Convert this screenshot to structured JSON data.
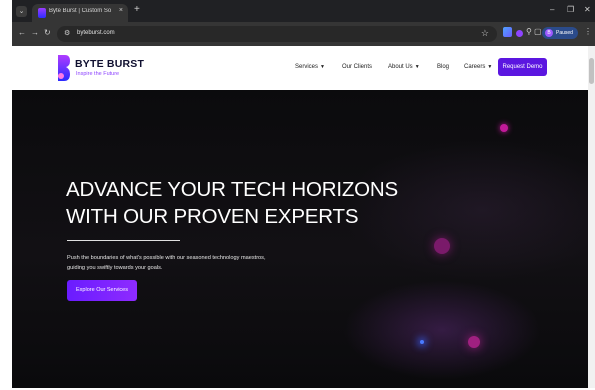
{
  "browser": {
    "tab_title": "Byte Burst | Custom Software",
    "tab_close": "×",
    "new_tab": "+",
    "tab_list": "⌄",
    "url": "byteburst.com",
    "profile_name": "Paused",
    "profile_initial": "B",
    "controls": {
      "minimize": "–",
      "maximize": "❐",
      "close": "✕"
    }
  },
  "site": {
    "logo_title": "BYTE BURST",
    "logo_tagline": "Inspire the Future",
    "nav": [
      {
        "label": "Services",
        "dropdown": true
      },
      {
        "label": "Our Clients",
        "dropdown": false
      },
      {
        "label": "About Us",
        "dropdown": true
      },
      {
        "label": "Blog",
        "dropdown": false
      },
      {
        "label": "Careers",
        "dropdown": true
      }
    ],
    "cta_label": "Request Demo",
    "brand_color": "#5b16e0"
  },
  "hero": {
    "title": "ADVANCE YOUR TECH HORIZONS WITH OUR PROVEN EXPERTS",
    "subtitle": "Push the boundaries of what's possible with our seasoned technology maestros, guiding you swiftly towards your goals.",
    "button_label": "Explore Our Services"
  }
}
